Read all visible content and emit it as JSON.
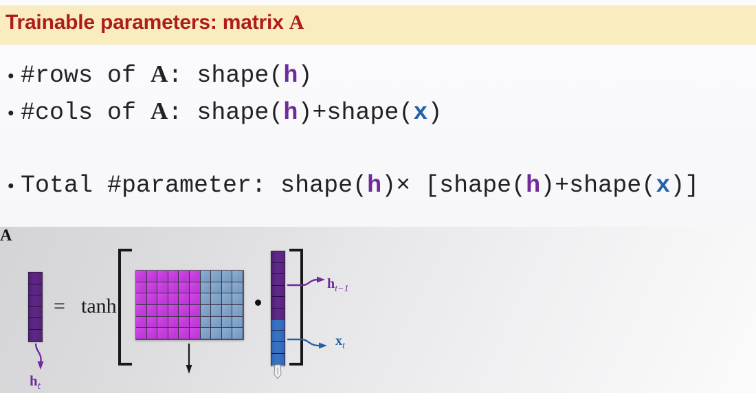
{
  "slide": {
    "title_plain": "Trainable parameters: matrix A",
    "title_prefix": "Trainable parameters: matrix ",
    "title_symbol": "A",
    "title_band_color": "#f9ecbe",
    "title_text_color": "#b01c1c",
    "background_color": "#f7f7f9"
  },
  "bullets": [
    {
      "dot": "•",
      "text": "#rows of A: shape(h)",
      "parts": {
        "p1": "#rows of ",
        "var_A": "A",
        "p2": ": shape(",
        "var_h": "h",
        "p3": ")"
      }
    },
    {
      "dot": "•",
      "text": "#cols of A: shape(h)+shape(x)",
      "parts": {
        "p1": "#cols of ",
        "var_A": "A",
        "p2": ": shape(",
        "var_h": "h",
        "p3": ")+shape(",
        "var_x": "x",
        "p4": ")"
      }
    },
    {
      "dot": "•",
      "text": "Total #parameter: shape(h)× [shape(h)+shape(x)]",
      "parts": {
        "p1": "Total #parameter: shape(",
        "var_h1": "h",
        "p2": ")× [shape(",
        "var_h2": "h",
        "p3": ")+shape(",
        "var_x": "x",
        "p4": ")]"
      }
    }
  ],
  "colors": {
    "h_variable": "#6f2b9c",
    "x_variable": "#2263a8",
    "matrix_magenta": "#c23ddb",
    "matrix_blue": "#7fa2c8",
    "vector_purple": "#5a2583",
    "vector_blue": "#3a74c4",
    "ink_black": "#18181a"
  },
  "diagram": {
    "equals_sign": "=",
    "activation_label": "tanh",
    "dot_operator": "·",
    "output_vector": {
      "name": "h_t",
      "label_var": "h",
      "label_sub": "t",
      "cells": 6,
      "color": "#5a2583"
    },
    "matrix": {
      "name": "A",
      "label": "A",
      "rows": 6,
      "cols": 10,
      "magenta_cols": 6,
      "blue_cols": 4,
      "magenta_color": "#c23ddb",
      "blue_color": "#7fa2c8"
    },
    "input_vector": {
      "total_cells": 10,
      "purple_cells": 6,
      "blue_cells": 4,
      "segments": [
        {
          "name": "h_{t-1}",
          "label_var": "h",
          "label_sub": "t−1",
          "cells": 6,
          "color": "#5a2583"
        },
        {
          "name": "x_t",
          "label_var": "x",
          "label_sub": "t",
          "cells": 4,
          "color": "#3a74c4"
        }
      ]
    },
    "brackets": {
      "left": "[",
      "right": "]"
    },
    "pen_cursor": "pen-cursor-icon"
  }
}
